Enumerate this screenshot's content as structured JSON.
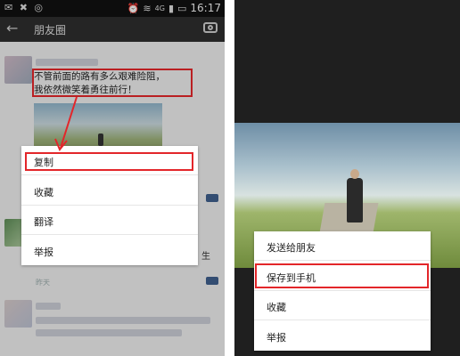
{
  "status_bar": {
    "time": "16:17",
    "network": "4G"
  },
  "header": {
    "title": "朋友圈"
  },
  "post": {
    "text_line1": "不管前面的路有多么艰难险阻，",
    "text_line2": "我依然微笑着勇往前行！"
  },
  "left_menu": {
    "items": [
      {
        "label": "复制"
      },
      {
        "label": "收藏"
      },
      {
        "label": "翻译"
      },
      {
        "label": "举报"
      }
    ],
    "selected_index": 0
  },
  "feed_extra": {
    "date_label": "昨天",
    "partial_text": "生"
  },
  "right_menu": {
    "items": [
      {
        "label": "发送给朋友"
      },
      {
        "label": "保存到手机"
      },
      {
        "label": "收藏"
      },
      {
        "label": "举报"
      }
    ],
    "selected_index": 1
  },
  "colors": {
    "highlight": "#e3262a",
    "header_bg": "#2e2e2e",
    "status_bg": "#101010"
  }
}
